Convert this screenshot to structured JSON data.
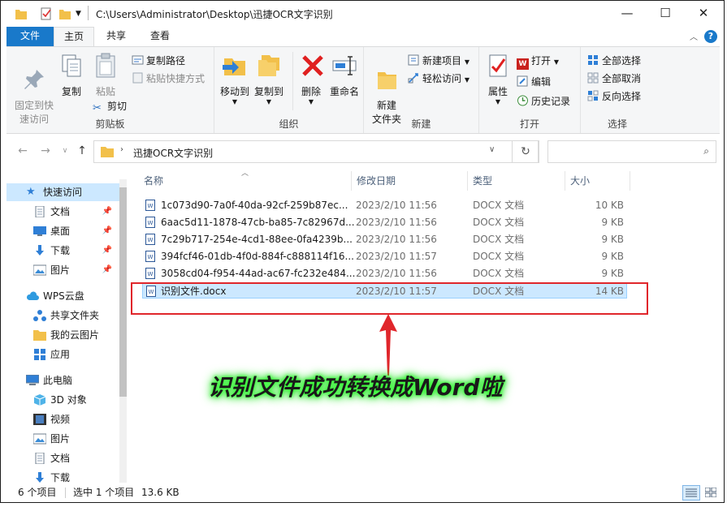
{
  "window": {
    "title": "C:\\Users\\Administrator\\Desktop\\迅捷OCR文字识别",
    "minimize": "—",
    "maximize": "☐",
    "close": "✕"
  },
  "ribbon_tabs": [
    "文件",
    "主页",
    "共享",
    "查看"
  ],
  "ribbon": {
    "clipboard": {
      "label": "剪贴板",
      "pin": "固定到快\n速访问",
      "copy": "复制",
      "paste": "粘贴",
      "copy_path": "复制路径",
      "paste_shortcut": "粘贴快捷方式",
      "cut": "剪切"
    },
    "organize": {
      "label": "组织",
      "move_to": "移动到",
      "copy_to": "复制到",
      "delete": "删除",
      "rename": "重命名"
    },
    "new": {
      "label": "新建",
      "new_folder": "新建\n文件夹",
      "new_item": "新建项目",
      "easy_access": "轻松访问"
    },
    "open": {
      "label": "打开",
      "properties": "属性",
      "open": "打开",
      "edit": "编辑",
      "history": "历史记录"
    },
    "select": {
      "label": "选择",
      "select_all": "全部选择",
      "select_none": "全部取消",
      "invert": "反向选择"
    }
  },
  "address": {
    "path": "迅捷OCR文字识别",
    "search_placeholder": ""
  },
  "sidebar": {
    "quick_access": "快速访问",
    "items": [
      {
        "label": "文档",
        "icon": "document-icon",
        "pinned": true
      },
      {
        "label": "桌面",
        "icon": "desktop-icon",
        "pinned": true
      },
      {
        "label": "下载",
        "icon": "download-icon",
        "pinned": true
      },
      {
        "label": "图片",
        "icon": "pictures-icon",
        "pinned": true
      }
    ],
    "wps_cloud": "WPS云盘",
    "wps_items": [
      {
        "label": "共享文件夹",
        "icon": "share-folder-icon"
      },
      {
        "label": "我的云图片",
        "icon": "folder-icon"
      },
      {
        "label": "应用",
        "icon": "apps-icon"
      }
    ],
    "this_pc": "此电脑",
    "pc_items": [
      {
        "label": "3D 对象",
        "icon": "3d-objects-icon"
      },
      {
        "label": "视频",
        "icon": "video-icon"
      },
      {
        "label": "图片",
        "icon": "pictures-icon"
      },
      {
        "label": "文档",
        "icon": "document-icon"
      },
      {
        "label": "下载",
        "icon": "download-icon"
      }
    ]
  },
  "columns": [
    "名称",
    "修改日期",
    "类型",
    "大小"
  ],
  "files": [
    {
      "name": "1c073d90-7a0f-40da-92cf-259b87ec...",
      "date": "2023/2/10 11:56",
      "type": "DOCX 文档",
      "size": "10 KB"
    },
    {
      "name": "6aac5d11-1878-47cb-ba85-7c82967d...",
      "date": "2023/2/10 11:56",
      "type": "DOCX 文档",
      "size": "9 KB"
    },
    {
      "name": "7c29b717-254e-4cd1-88ee-0fa4239b...",
      "date": "2023/2/10 11:56",
      "type": "DOCX 文档",
      "size": "9 KB"
    },
    {
      "name": "394fcf46-01db-4f0d-884f-c888114f16...",
      "date": "2023/2/10 11:57",
      "type": "DOCX 文档",
      "size": "9 KB"
    },
    {
      "name": "3058cd04-f954-44ad-ac67-fc232e484...",
      "date": "2023/2/10 11:56",
      "type": "DOCX 文档",
      "size": "9 KB"
    },
    {
      "name": "识别文件.docx",
      "date": "2023/2/10 11:57",
      "type": "DOCX 文档",
      "size": "14 KB",
      "selected": true
    }
  ],
  "status": {
    "count": "6 个项目",
    "selected": "选中 1 个项目",
    "size": "13.6 KB"
  },
  "annotation": "识别文件成功转换成Word啦",
  "colors": {
    "accent": "#1979ca",
    "selection": "#cce8ff",
    "highlight_box": "#e0262b",
    "annotation_glow": "#3bff3b"
  }
}
